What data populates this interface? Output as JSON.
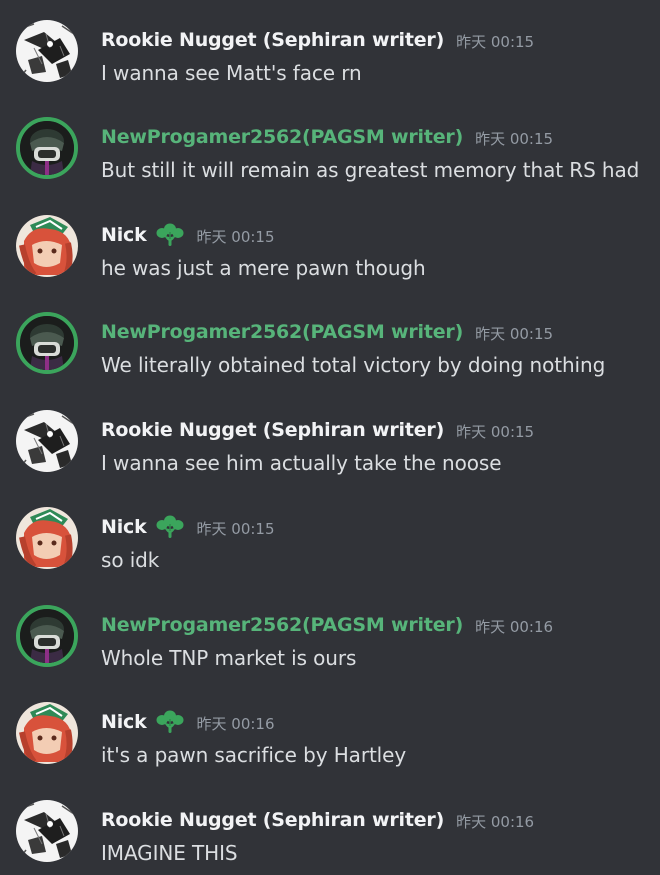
{
  "colors": {
    "background": "#313338",
    "default_name": "#f2f3f5",
    "writer_green": "#57b47a",
    "timestamp": "#949ba4",
    "message_text": "#dbdee1",
    "avatar_ring": "#3ba55c"
  },
  "messages": [
    {
      "author": "Rookie Nugget (Sephiran writer)",
      "author_color": "default",
      "avatar": "sketch-avatar",
      "role_icon": false,
      "timestamp": "昨天 00:15",
      "text": "I wanna see Matt's face rn"
    },
    {
      "author": "NewProgamer2562(PAGSM writer)",
      "author_color": "green",
      "avatar": "dark-masked-avatar",
      "role_icon": false,
      "timestamp": "昨天 00:15",
      "text": "But still it will remain as greatest memory that RS had"
    },
    {
      "author": "Nick",
      "author_color": "default",
      "avatar": "red-hair-avatar",
      "role_icon": true,
      "timestamp": "昨天 00:15",
      "text": "he was just a mere pawn though"
    },
    {
      "author": "NewProgamer2562(PAGSM writer)",
      "author_color": "green",
      "avatar": "dark-masked-avatar",
      "role_icon": false,
      "timestamp": "昨天 00:15",
      "text": "We literally obtained total victory by doing nothing"
    },
    {
      "author": "Rookie Nugget (Sephiran writer)",
      "author_color": "default",
      "avatar": "sketch-avatar",
      "role_icon": false,
      "timestamp": "昨天 00:15",
      "text": "I wanna see him actually take the noose"
    },
    {
      "author": "Nick",
      "author_color": "default",
      "avatar": "red-hair-avatar",
      "role_icon": true,
      "timestamp": "昨天 00:15",
      "text": "so idk"
    },
    {
      "author": "NewProgamer2562(PAGSM writer)",
      "author_color": "green",
      "avatar": "dark-masked-avatar",
      "role_icon": false,
      "timestamp": "昨天 00:16",
      "text": "Whole TNP market is ours"
    },
    {
      "author": "Nick",
      "author_color": "default",
      "avatar": "red-hair-avatar",
      "role_icon": true,
      "timestamp": "昨天 00:16",
      "text": "it's a pawn sacrifice by Hartley"
    },
    {
      "author": "Rookie Nugget (Sephiran writer)",
      "author_color": "default",
      "avatar": "sketch-avatar",
      "role_icon": false,
      "timestamp": "昨天 00:16",
      "text": "IMAGINE THIS"
    }
  ]
}
